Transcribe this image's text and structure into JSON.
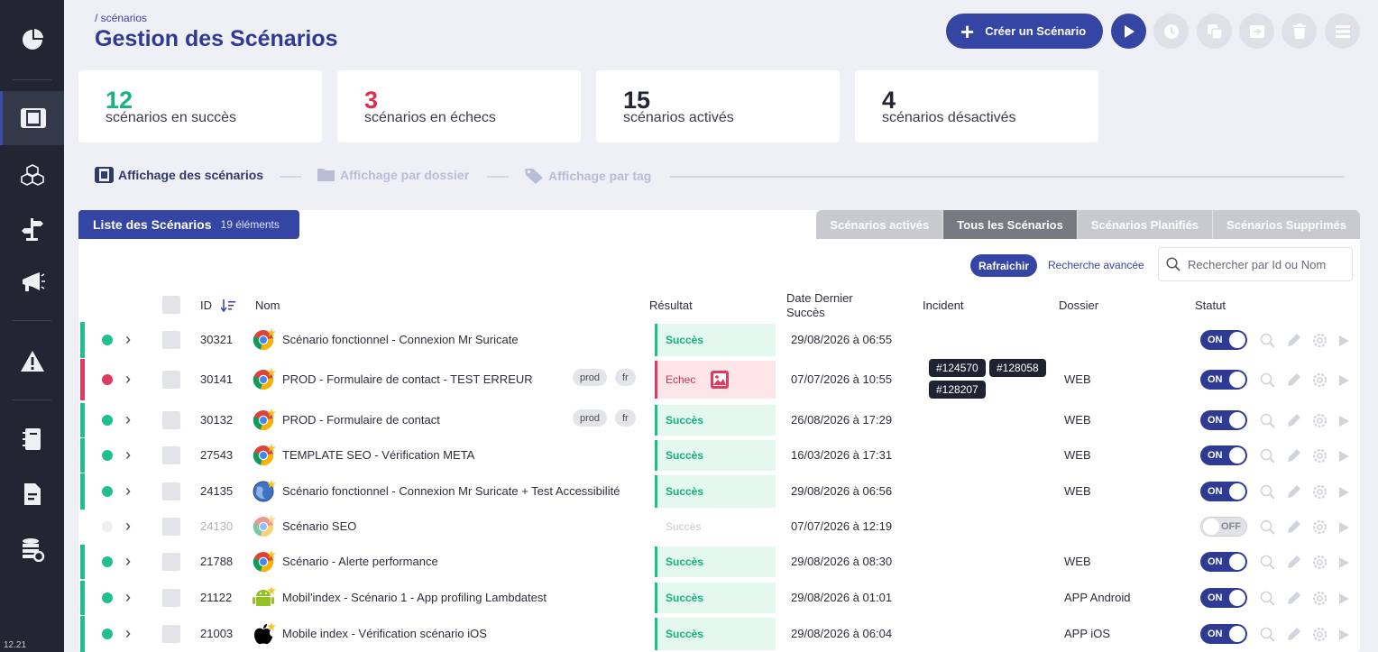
{
  "app": {
    "version": "12.21"
  },
  "sidebar": {
    "items": [
      {
        "icon": "pie-chart-icon"
      },
      {
        "icon": "film-icon",
        "active": true
      },
      {
        "icon": "cubes-icon"
      },
      {
        "icon": "signpost-icon"
      },
      {
        "icon": "megaphone-icon"
      },
      {
        "icon": "warning-icon"
      },
      {
        "icon": "notebook-icon"
      },
      {
        "icon": "document-icon"
      },
      {
        "icon": "database-gear-icon"
      }
    ]
  },
  "header": {
    "breadcrumb": "/ scénarios",
    "title": "Gestion des Scénarios",
    "create_label": "Créer un Scénario"
  },
  "stats": [
    {
      "value": "12",
      "label": "scénarios en succès",
      "color": "#19b47e"
    },
    {
      "value": "3",
      "label": "scénarios en échecs",
      "color": "#d7304f"
    },
    {
      "value": "15",
      "label": "scénarios activés",
      "color": "#232632"
    },
    {
      "value": "4",
      "label": "scénarios désactivés",
      "color": "#232632"
    }
  ],
  "views": {
    "list": "Affichage des scénarios",
    "folder": "Affichage par dossier",
    "tag": "Affichage par tag"
  },
  "list": {
    "title": "Liste des Scénarios",
    "count": "19 éléments",
    "tabs": [
      "Scénarios activés",
      "Tous les Scénarios",
      "Scénarios Planifiés",
      "Scénarios Supprimés"
    ],
    "selected_tab": "Tous les Scénarios",
    "refresh_label": "Rafraichir",
    "advanced_label": "Recherche avancée",
    "search_placeholder": "Rechercher par Id ou Nom",
    "columns": {
      "id": "ID",
      "name": "Nom",
      "result": "Résultat",
      "date": "Date Dernier Succès",
      "incident": "Incident",
      "folder": "Dossier",
      "status": "Statut"
    }
  },
  "rows": [
    {
      "id": "30321",
      "name": "Scénario fonctionnel - Connexion Mr Suricate",
      "icon": "chrome-icon",
      "tags": [],
      "result": "Succès",
      "date": "29/08/2026 à 06:55",
      "incidents": [],
      "folder": "",
      "status": "ON"
    },
    {
      "id": "30141",
      "name": "PROD - Formulaire de contact - TEST ERREUR",
      "icon": "chrome-icon",
      "tags": [
        "prod",
        "fr"
      ],
      "result": "Echec",
      "date": "07/07/2026 à 10:55",
      "incidents": [
        "#124570",
        "#128058",
        "#128207"
      ],
      "folder": "WEB",
      "status": "ON"
    },
    {
      "id": "30132",
      "name": "PROD - Formulaire de contact",
      "icon": "chrome-icon",
      "tags": [
        "prod",
        "fr"
      ],
      "result": "Succès",
      "date": "26/08/2026 à 17:29",
      "incidents": [],
      "folder": "WEB",
      "status": "ON"
    },
    {
      "id": "27543",
      "name": "TEMPLATE SEO - Vérification META",
      "icon": "chrome-icon",
      "tags": [],
      "result": "Succès",
      "date": "16/03/2026 à 17:31",
      "incidents": [],
      "folder": "WEB",
      "status": "ON"
    },
    {
      "id": "24135",
      "name": "Scénario fonctionnel - Connexion Mr Suricate + Test Accessibilité",
      "icon": "globe-icon",
      "tags": [],
      "result": "Succès",
      "date": "29/08/2026 à 06:56",
      "incidents": [],
      "folder": "WEB",
      "status": "ON"
    },
    {
      "id": "24130",
      "name": "Scénario SEO",
      "icon": "chrome-icon",
      "tags": [],
      "result": "Succès",
      "date": "07/07/2026 à 12:19",
      "incidents": [],
      "folder": "",
      "status": "OFF"
    },
    {
      "id": "21788",
      "name": "Scénario - Alerte performance",
      "icon": "chrome-icon",
      "tags": [],
      "result": "Succès",
      "date": "29/08/2026 à 08:30",
      "incidents": [],
      "folder": "WEB",
      "status": "ON"
    },
    {
      "id": "21122",
      "name": "Mobil'index - Scénario 1 - App profiling Lambdatest",
      "icon": "android-icon",
      "tags": [],
      "result": "Succès",
      "date": "29/08/2026 à 01:01",
      "incidents": [],
      "folder": "APP Android",
      "status": "ON"
    },
    {
      "id": "21003",
      "name": "Mobile index - Vérification scénario iOS",
      "icon": "apple-icon",
      "tags": [],
      "result": "Succès",
      "date": "29/08/2026 à 06:04",
      "incidents": [],
      "folder": "APP iOS",
      "status": "ON"
    }
  ],
  "colors": {
    "accent": "#3545a3",
    "success": "#1fbf8f",
    "failure": "#e03a5e",
    "sidebar": "#232632"
  }
}
